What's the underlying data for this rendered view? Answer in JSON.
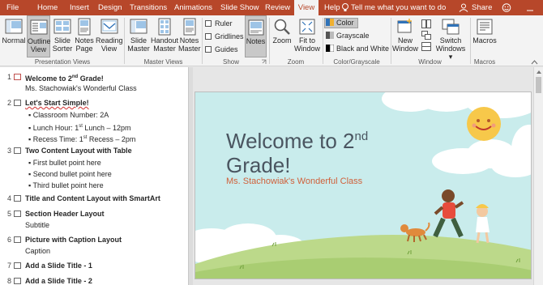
{
  "tabs": {
    "file": "File",
    "home": "Home",
    "insert": "Insert",
    "design": "Design",
    "transitions": "Transitions",
    "animations": "Animations",
    "slideshow": "Slide Show",
    "review": "Review",
    "view": "View",
    "help": "Help"
  },
  "tell_me": "Tell me what you want to do",
  "share": "Share",
  "ribbon": {
    "presentation_views": {
      "label": "Presentation Views",
      "normal": "Normal",
      "outline_l1": "Outline",
      "outline_l2": "View",
      "sorter_l1": "Slide",
      "sorter_l2": "Sorter",
      "notes_l1": "Notes",
      "notes_l2": "Page",
      "reading_l1": "Reading",
      "reading_l2": "View"
    },
    "master_views": {
      "label": "Master Views",
      "slide_l1": "Slide",
      "slide_l2": "Master",
      "handout_l1": "Handout",
      "handout_l2": "Master",
      "notes_l1": "Notes",
      "notes_l2": "Master"
    },
    "show": {
      "label": "Show",
      "ruler": "Ruler",
      "gridlines": "Gridlines",
      "guides": "Guides",
      "notes": "Notes"
    },
    "zoom": {
      "label": "Zoom",
      "zoom": "Zoom",
      "fit_l1": "Fit to",
      "fit_l2": "Window"
    },
    "color": {
      "label": "Color/Grayscale",
      "color": "Color",
      "grayscale": "Grayscale",
      "bw": "Black and White"
    },
    "window": {
      "label": "Window",
      "new_l1": "New",
      "new_l2": "Window",
      "switch_l1": "Switch",
      "switch_l2": "Windows"
    },
    "macros": {
      "label": "Macros",
      "macros": "Macros"
    }
  },
  "outline": {
    "slides": [
      {
        "num": "1",
        "title_a": "Welcome to 2",
        "title_sup": "nd",
        "title_b": " Grade!",
        "subtitle": "Ms. Stachowiak's Wonderful Class"
      },
      {
        "num": "2",
        "title": "Let's Start Simple!",
        "b1": "Classroom Number: 2A",
        "b2_a": "Lunch Hour: 1",
        "b2_sup": "st",
        "b2_b": " Lunch – 12pm",
        "b3_a": "Recess Time: 1",
        "b3_sup": "st",
        "b3_b": " Recess – 2pm"
      },
      {
        "num": "3",
        "title": "Two Content Layout with Table",
        "b1": "First bullet point here",
        "b2": "Second bullet point here",
        "b3": "Third bullet point here"
      },
      {
        "num": "4",
        "title": "Title and Content Layout with SmartArt"
      },
      {
        "num": "5",
        "title": "Section Header Layout",
        "subtitle": "Subtitle"
      },
      {
        "num": "6",
        "title": "Picture with Caption Layout",
        "subtitle": "Caption"
      },
      {
        "num": "7",
        "title": "Add a Slide Title - 1"
      },
      {
        "num": "8",
        "title": "Add a Slide Title - 2"
      }
    ]
  },
  "slide": {
    "title_a": "Welcome to 2",
    "title_sup": "nd",
    "title_b": "Grade!",
    "subtitle": "Ms. Stachowiak's Wonderful Class"
  },
  "colors": {
    "accent": "#b7472a",
    "slide_bg": "#c9ecec",
    "subtitle": "#d0603a",
    "title": "#4a5560"
  }
}
